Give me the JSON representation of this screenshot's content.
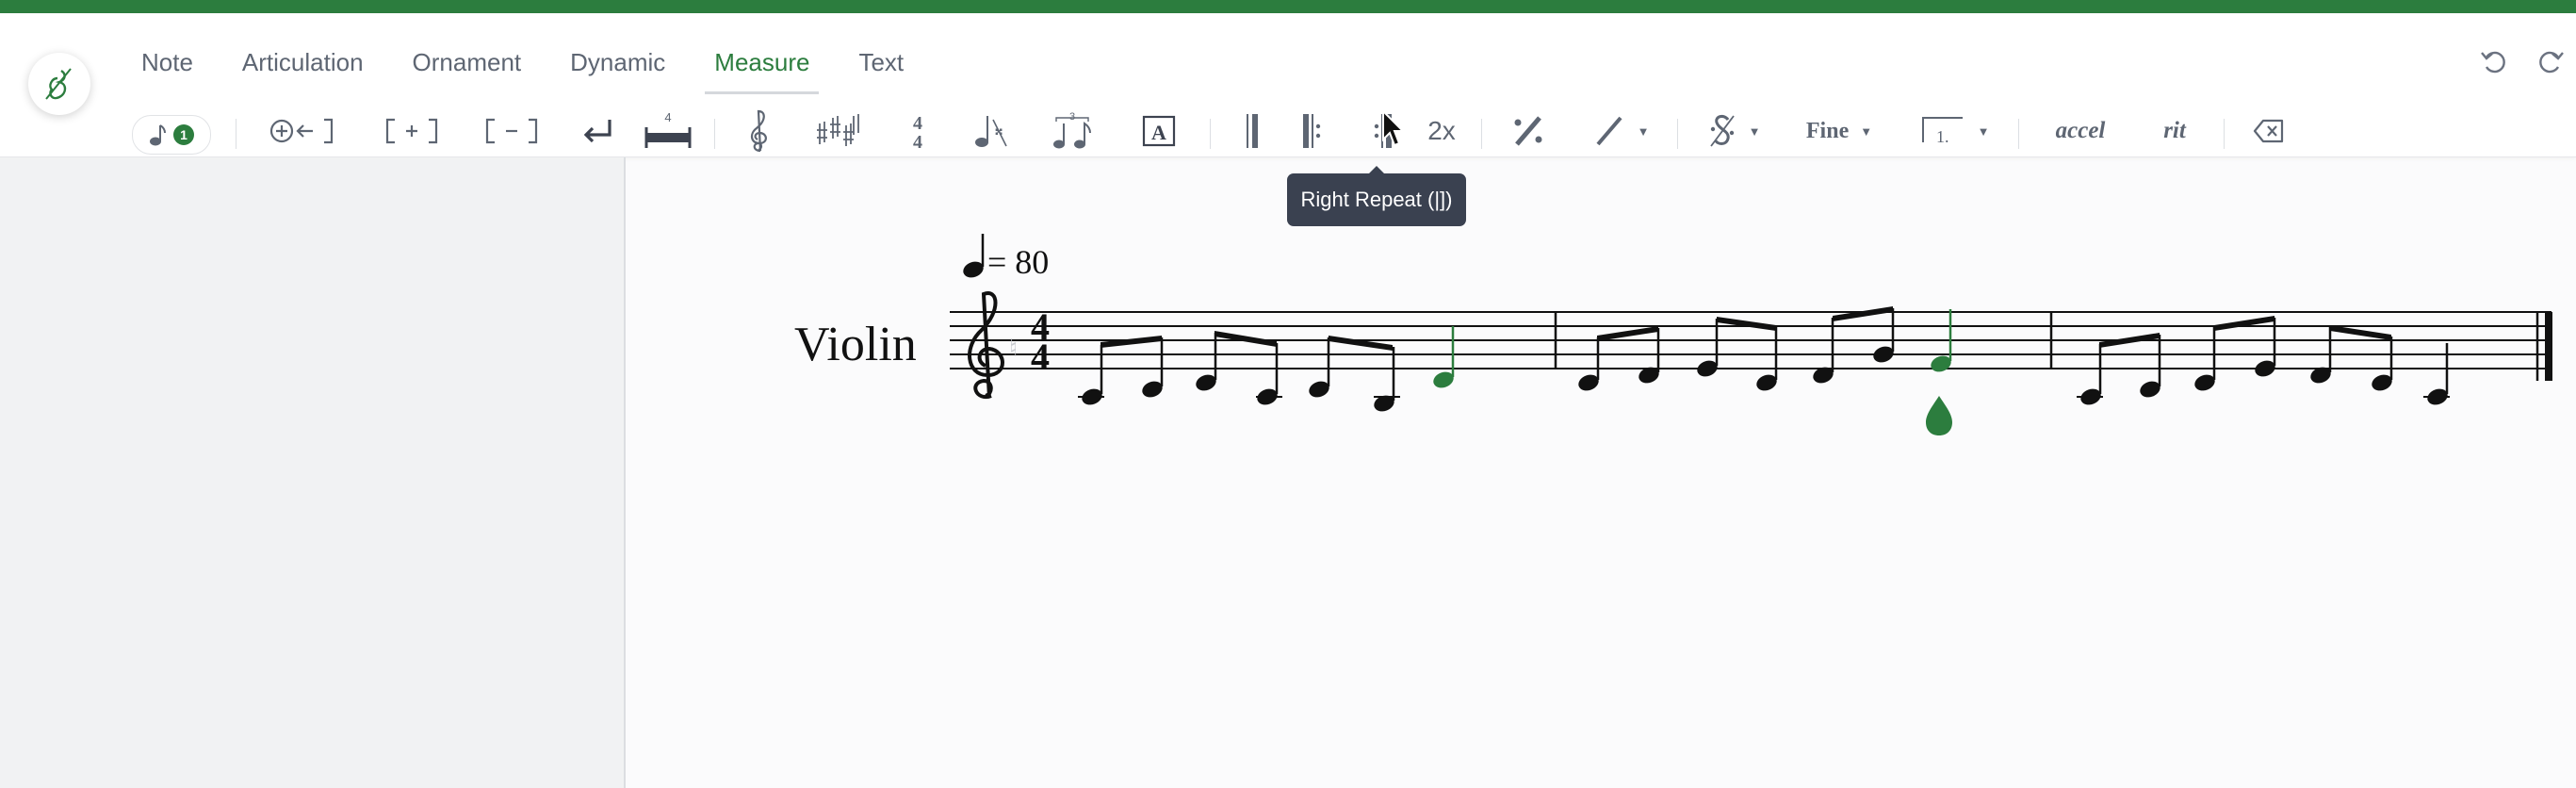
{
  "app": {
    "accent": "#2c7d3e",
    "logo_icon": "violin-logo-icon"
  },
  "tabs": [
    {
      "label": "Note",
      "active": false
    },
    {
      "label": "Articulation",
      "active": false
    },
    {
      "label": "Ornament",
      "active": false
    },
    {
      "label": "Dynamic",
      "active": false
    },
    {
      "label": "Measure",
      "active": true
    },
    {
      "label": "Text",
      "active": false
    }
  ],
  "history": {
    "undo_icon": "undo-icon",
    "redo_icon": "redo-icon"
  },
  "toolbar": {
    "voice_badge": "1",
    "time_signature_number": "4",
    "repeat_count_label": "2x",
    "fine_label": "Fine",
    "ending_label": "1.",
    "accel_label": "accel",
    "rit_label": "rit",
    "text_box_glyph": "A",
    "hovered_tool": "right-repeat"
  },
  "tooltip": {
    "text": "Right Repeat (|])"
  },
  "score": {
    "tempo_value": "= 80",
    "instrument": "Violin",
    "time_signature": {
      "top": "4",
      "bottom": "4"
    },
    "clef": "treble",
    "note_color_selected": "#2c7d3e",
    "measures": 3
  }
}
